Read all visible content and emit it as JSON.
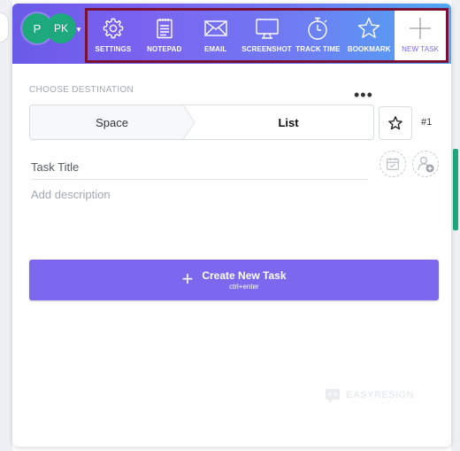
{
  "header": {
    "avatars": [
      {
        "initials": "P",
        "color": "#1ea97c"
      },
      {
        "initials": "PK",
        "color": "#1ea97c"
      }
    ],
    "avatar_caret": "chevron-down-icon",
    "toolbar": [
      {
        "label": "SETTINGS",
        "icon": "gear-icon",
        "active": false
      },
      {
        "label": "NOTEPAD",
        "icon": "notepad-icon",
        "active": false
      },
      {
        "label": "EMAIL",
        "icon": "envelope-icon",
        "active": false
      },
      {
        "label": "SCREENSHOT",
        "icon": "monitor-icon",
        "active": false
      },
      {
        "label": "TRACK TIME",
        "icon": "stopwatch-icon",
        "active": false
      },
      {
        "label": "BOOKMARK",
        "icon": "star-icon",
        "active": false
      },
      {
        "label": "NEW TASK",
        "icon": "plus-icon",
        "active": true
      }
    ],
    "gradient": [
      "#6a5ae8",
      "#7b63f0",
      "#6f7cf3",
      "#4fa9f3"
    ],
    "highlight_border_color": "#7a1238"
  },
  "destination": {
    "label": "CHOOSE DESTINATION",
    "more_icon": "more-horizontal-icon",
    "space": "Space",
    "list": "List",
    "star_icon": "star-outline-icon",
    "task_number": "#1"
  },
  "task": {
    "title_placeholder": "Task Title",
    "title_value": "",
    "description_placeholder": "Add description",
    "description_value": "",
    "date_icon": "calendar-check-icon",
    "assignee_icon": "add-user-icon"
  },
  "create": {
    "label": "Create New Task",
    "shortcut": "ctrl+enter",
    "icon": "plus-icon",
    "color": "#7b68ee"
  },
  "watermark": {
    "text": "EASYRESIGN",
    "icon": "mascot-icon"
  },
  "colors": {
    "accent": "#7b68ee",
    "avatar_green": "#1ea97c"
  }
}
